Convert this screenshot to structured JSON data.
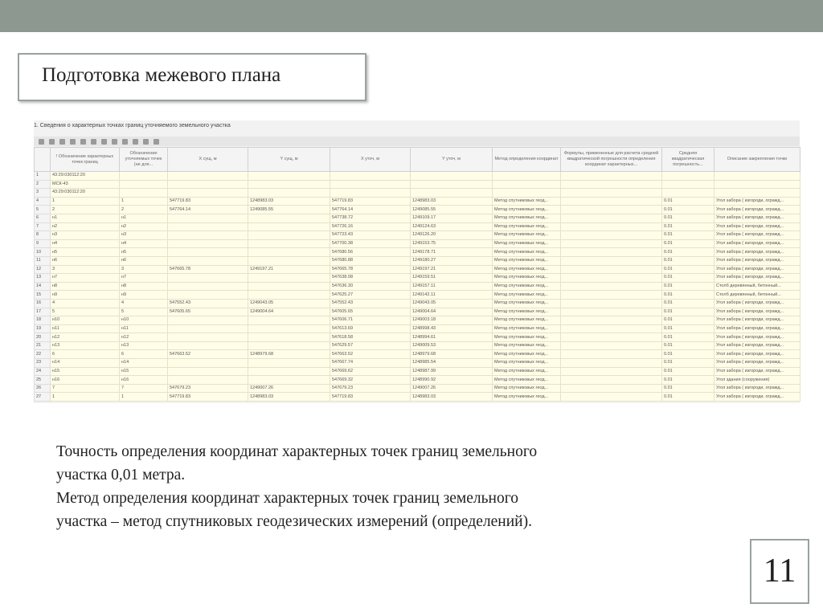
{
  "slide": {
    "title": "Подготовка межевого плана",
    "page_number": "11",
    "body": [
      "Точность определения координат характерных точек границ земельного",
      "участка 0,01 метра.",
      "Метод определения координат характерных точек границ земельного",
      "участка – метод спутниковых геодезических измерений (определений)."
    ]
  },
  "table": {
    "caption": "1. Сведения о характерных точках границ уточняемого земельного участка",
    "headers": [
      "! Обозначение характерных точек границ",
      "Обозначение уточняемых точек (не для...",
      "X сущ, м",
      "Y сущ, м",
      "X уточ, м",
      "Y уточ, м",
      "Метод определения координат",
      "Формулы, примененные для расчета средней квадратической погрешности определения координат характерных...",
      "Средняя квадратическая погрешность...",
      "Описание закрепления точки"
    ],
    "rows": [
      [
        "1",
        "43:29:030112:20",
        "",
        "",
        "",
        "",
        "",
        "",
        "",
        "",
        ""
      ],
      [
        "2",
        "МСК-43",
        "",
        "",
        "",
        "",
        "",
        "",
        "",
        "",
        ""
      ],
      [
        "3",
        "43:29:030112:20",
        "",
        "",
        "",
        "",
        "",
        "",
        "",
        "",
        ""
      ],
      [
        "4",
        "1",
        "1",
        "547719.83",
        "1248983.03",
        "547719.83",
        "1248983.03",
        "Метод спутниковых геод...",
        "",
        "0.01",
        "Угол забора ( изгороди, огражд..."
      ],
      [
        "5",
        "2",
        "2",
        "547764.14",
        "1249085.55",
        "547764.14",
        "1249085.55",
        "Метод спутниковых геод...",
        "",
        "0.01",
        "Угол забора ( изгороди, огражд..."
      ],
      [
        "6",
        "н1",
        "н1",
        "",
        "",
        "547738.72",
        "1249109.17",
        "Метод спутниковых геод...",
        "",
        "0.01",
        "Угол забора ( изгороди, огражд..."
      ],
      [
        "7",
        "н2",
        "н2",
        "",
        "",
        "547726.16",
        "1249124.63",
        "Метод спутниковых геод...",
        "",
        "0.01",
        "Угол забора ( изгороди, огражд..."
      ],
      [
        "8",
        "н3",
        "н3",
        "",
        "",
        "547723.43",
        "1249126.20",
        "Метод спутниковых геод...",
        "",
        "0.01",
        "Угол забора ( изгороди, огражд..."
      ],
      [
        "9",
        "н4",
        "н4",
        "",
        "",
        "547700.38",
        "1249153.75",
        "Метод спутниковых геод...",
        "",
        "0.01",
        "Угол забора ( изгороди, огражд..."
      ],
      [
        "10",
        "н5",
        "н5",
        "",
        "",
        "547680.56",
        "1249178.71",
        "Метод спутниковых геод...",
        "",
        "0.01",
        "Угол забора ( изгороди, огражд..."
      ],
      [
        "11",
        "н6",
        "н6",
        "",
        "",
        "547680.88",
        "1249180.27",
        "Метод спутниковых геод...",
        "",
        "0.01",
        "Угол забора ( изгороди, огражд..."
      ],
      [
        "12",
        "3",
        "3",
        "547665.78",
        "1249197.21",
        "547665.78",
        "1249197.21",
        "Метод спутниковых геод...",
        "",
        "0.01",
        "Угол забора ( изгороди, огражд..."
      ],
      [
        "13",
        "н7",
        "н7",
        "",
        "",
        "547638.08",
        "1249159.51",
        "Метод спутниковых геод...",
        "",
        "0.01",
        "Угол забора ( изгороди, огражд..."
      ],
      [
        "14",
        "н8",
        "н8",
        "",
        "",
        "547636.30",
        "1249157.11",
        "Метод спутниковых геод...",
        "",
        "0.01",
        "Столб деревянный, бетонный..."
      ],
      [
        "15",
        "н9",
        "н9",
        "",
        "",
        "547625.27",
        "1249142.11",
        "Метод спутниковых геод...",
        "",
        "0.01",
        "Столб деревянный, бетонный..."
      ],
      [
        "16",
        "4",
        "4",
        "547552.43",
        "1249043.05",
        "547552.43",
        "1249043.05",
        "Метод спутниковых геод...",
        "",
        "0.01",
        "Угол забора ( изгороди, огражд..."
      ],
      [
        "17",
        "5",
        "5",
        "547605.65",
        "1249004.64",
        "547605.65",
        "1249004.64",
        "Метод спутниковых геод...",
        "",
        "0.01",
        "Угол забора ( изгороди, огражд..."
      ],
      [
        "18",
        "н10",
        "н10",
        "",
        "",
        "547606.71",
        "1249003.18",
        "Метод спутниковых геод...",
        "",
        "0.01",
        "Угол забора ( изгороди, огражд..."
      ],
      [
        "19",
        "н11",
        "н11",
        "",
        "",
        "547613.69",
        "1248998.43",
        "Метод спутниковых геод...",
        "",
        "0.01",
        "Угол забора ( изгороди, огражд..."
      ],
      [
        "20",
        "н12",
        "н12",
        "",
        "",
        "547618.58",
        "1248994.61",
        "Метод спутниковых геод...",
        "",
        "0.01",
        "Угол забора ( изгороди, огражд..."
      ],
      [
        "21",
        "н13",
        "н13",
        "",
        "",
        "547629.57",
        "1249009.53",
        "Метод спутниковых геод...",
        "",
        "0.01",
        "Угол забора ( изгороди, огражд..."
      ],
      [
        "22",
        "6",
        "6",
        "547663.52",
        "1248979.68",
        "547663.52",
        "1248979.68",
        "Метод спутниковых геод...",
        "",
        "0.01",
        "Угол забора ( изгороди, огражд..."
      ],
      [
        "23",
        "н14",
        "н14",
        "",
        "",
        "547667.74",
        "1248985.54",
        "Метод спутниковых геод...",
        "",
        "0.01",
        "Угол забора ( изгороди, огражд..."
      ],
      [
        "24",
        "н15",
        "н15",
        "",
        "",
        "547669.62",
        "1248987.99",
        "Метод спутниковых геод...",
        "",
        "0.01",
        "Угол забора ( изгороди, огражд..."
      ],
      [
        "25",
        "н16",
        "н16",
        "",
        "",
        "547669.32",
        "1248990.92",
        "Метод спутниковых геод...",
        "",
        "0.01",
        "Угол здания (сооружения)"
      ],
      [
        "26",
        "7",
        "7",
        "547679.23",
        "1249007.26",
        "547679.23",
        "1249007.26",
        "Метод спутниковых геод...",
        "",
        "0.01",
        "Угол забора ( изгороди, огражд..."
      ],
      [
        "27",
        "1",
        "1",
        "547719.83",
        "1248983.03",
        "547719.83",
        "1248983.03",
        "Метод спутниковых геод...",
        "",
        "0.01",
        "Угол забора ( изгороди, огражд..."
      ]
    ]
  }
}
